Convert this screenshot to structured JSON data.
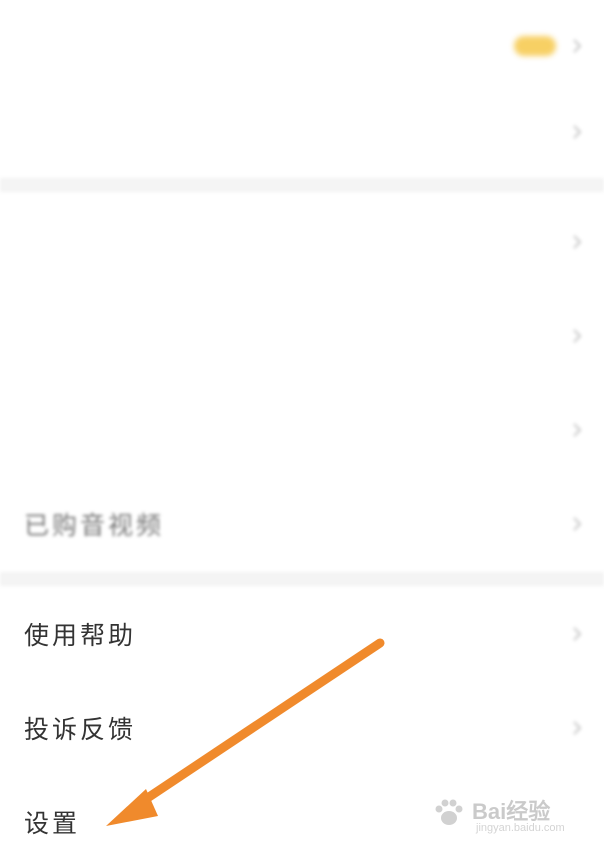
{
  "menu_groups": [
    {
      "items": [
        {
          "label": "",
          "has_badge": true
        },
        {
          "label": ""
        }
      ]
    },
    {
      "items": [
        {
          "label": ""
        },
        {
          "label": ""
        },
        {
          "label": ""
        },
        {
          "label": "已购音视频"
        }
      ]
    },
    {
      "items": [
        {
          "label": "使用帮助"
        },
        {
          "label": "投诉反馈"
        },
        {
          "label": "设置"
        }
      ]
    }
  ],
  "icons": {
    "row_chevron": "chevron-right-icon",
    "annotation": "orange-arrow-icon"
  },
  "colors": {
    "badge": "#f6c84a",
    "arrow": "#f08a2c",
    "divider": "#f4f4f4"
  },
  "watermark": {
    "brand": "Bai经验",
    "sub": "jingyan.baidu.com"
  }
}
